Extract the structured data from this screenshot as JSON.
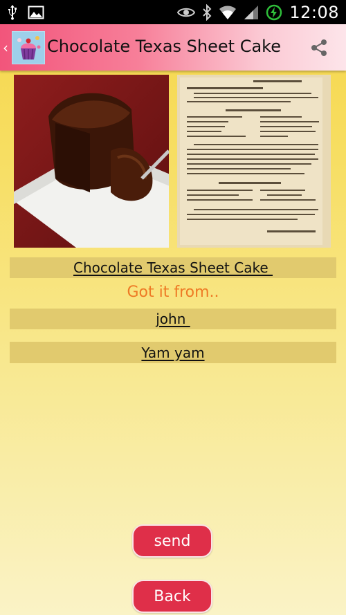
{
  "status_bar": {
    "time": "12:08",
    "icons": [
      "usb-icon",
      "image-icon",
      "eye-icon",
      "bluetooth-icon",
      "wifi-icon",
      "signal-icon",
      "battery-charging-icon"
    ]
  },
  "action_bar": {
    "title": "Chocolate Texas Sheet Cake",
    "up_caret": "‹",
    "logo_icon": "cupcake-icon",
    "share_icon": "share-icon"
  },
  "images": {
    "cake_photo": "chocolate-cake-photo",
    "recipe_card": "recipe-clipping-image"
  },
  "fields": {
    "recipe_name": "Chocolate Texas Sheet Cake ",
    "got_it_from_label": "Got it from..",
    "source_name": "john ",
    "author_name": "Yam yam"
  },
  "buttons": {
    "send": "send",
    "back": "Back"
  },
  "colors": {
    "action_bar_start": "#f2557b",
    "row_background": "#e1ca6e",
    "label_orange": "#ee7a25",
    "button_red": "#df2f49"
  }
}
